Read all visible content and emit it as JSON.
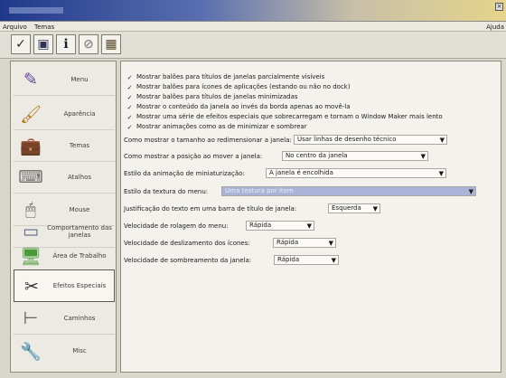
{
  "menubar": {
    "file": "Arquivo",
    "themes": "Temas",
    "help": "Ajuda"
  },
  "toolbar": {
    "buttons": [
      {
        "name": "apply-check-icon",
        "glyph": "✓"
      },
      {
        "name": "save-icon",
        "glyph": "▣"
      },
      {
        "name": "info-icon",
        "glyph": "ℹ"
      },
      {
        "name": "disabled-icon",
        "glyph": "⊘"
      },
      {
        "name": "grid-icon",
        "glyph": "▦"
      }
    ]
  },
  "sidebar": {
    "items": [
      {
        "label": "Menu",
        "icon": "✎"
      },
      {
        "label": "Aparência",
        "icon": "🖌"
      },
      {
        "label": "Temas",
        "icon": "💼"
      },
      {
        "label": "Atalhos",
        "icon": "⌨"
      },
      {
        "label": "Mouse",
        "icon": "🖱"
      },
      {
        "label": "Comportamento das janelas",
        "icon": "▭"
      },
      {
        "label": "Área de Trabalho",
        "icon": "🖥"
      },
      {
        "label": "Efeitos Especiais",
        "icon": "✂"
      },
      {
        "label": "Caminhos",
        "icon": "⊢"
      },
      {
        "label": "Misc",
        "icon": "🔧"
      }
    ]
  },
  "options": [
    "Mostrar balões para títulos de janelas parcialmente visíveis",
    "Mostrar balões para ícones de aplicações (estando ou não no dock)",
    "Mostrar balões para títulos de janelas minimizadas",
    "Mostrar o conteúdo da janela ao invés da borda apenas ao movê-la",
    "Mostrar uma série de efeitos especiais que sobrecarregam e tornam o Window Maker mais lento",
    "Mostrar animações como as de minimizar e sombrear"
  ],
  "settings": [
    {
      "label": "Como mostrar o tamanho ao redimensionar a janela:",
      "value": "Usar linhas de desenho técnico"
    },
    {
      "label": "Como mostrar a posição ao mover a janela:",
      "value": "No centro da janela"
    },
    {
      "label": "Estilo da animação de miniaturização:",
      "value": "A janela é encolhida"
    },
    {
      "label": "Estilo da textura do menu:",
      "value": "Uma textura por item"
    },
    {
      "label": "Justificação do texto em uma barra de título de janela:",
      "value": "Esquerda"
    },
    {
      "label": "Velocidade de rolagem do menu:",
      "value": "Rápida"
    },
    {
      "label": "Velocidade de deslizamento dos ícones:",
      "value": "Rápida"
    },
    {
      "label": "Velocidade de sombreamento da janela:",
      "value": "Rápida"
    }
  ]
}
